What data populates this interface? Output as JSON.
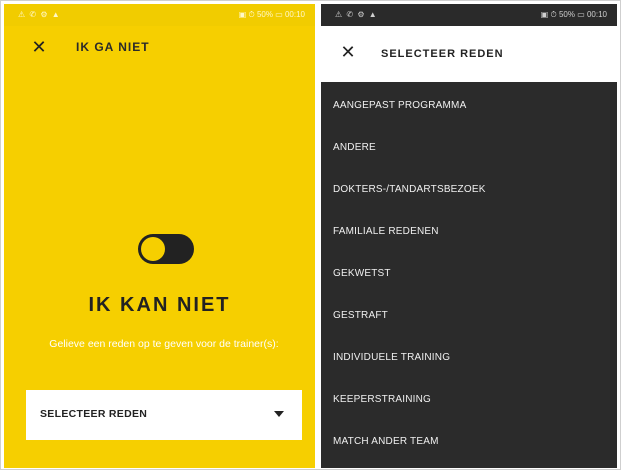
{
  "left": {
    "status_left": "⚠ ✆ ⚙ ▲",
    "status_right": "▣ ⏱ 50% ▭ 00:10",
    "title": "IK GA NIET",
    "toggle_state": "off",
    "heading": "IK KAN NIET",
    "subtitle": "Gelieve een reden op te geven voor de trainer(s):",
    "select_label": "SELECTEER REDEN"
  },
  "right": {
    "status_left": "⚠ ✆ ⚙ ▲",
    "status_right": "▣ ⏱ 50% ▭ 00:10",
    "title": "SELECTEER REDEN",
    "reasons": [
      "AANGEPAST PROGRAMMA",
      "ANDERE",
      "DOKTERS-/TANDARTSBEZOEK",
      "FAMILIALE REDENEN",
      "GEKWETST",
      "GESTRAFT",
      "INDIVIDUELE TRAINING",
      "KEEPERSTRAINING",
      "MATCH ANDER TEAM"
    ]
  },
  "colors": {
    "accent_yellow": "#f6cf00",
    "dark_panel": "#2b2b2b"
  }
}
